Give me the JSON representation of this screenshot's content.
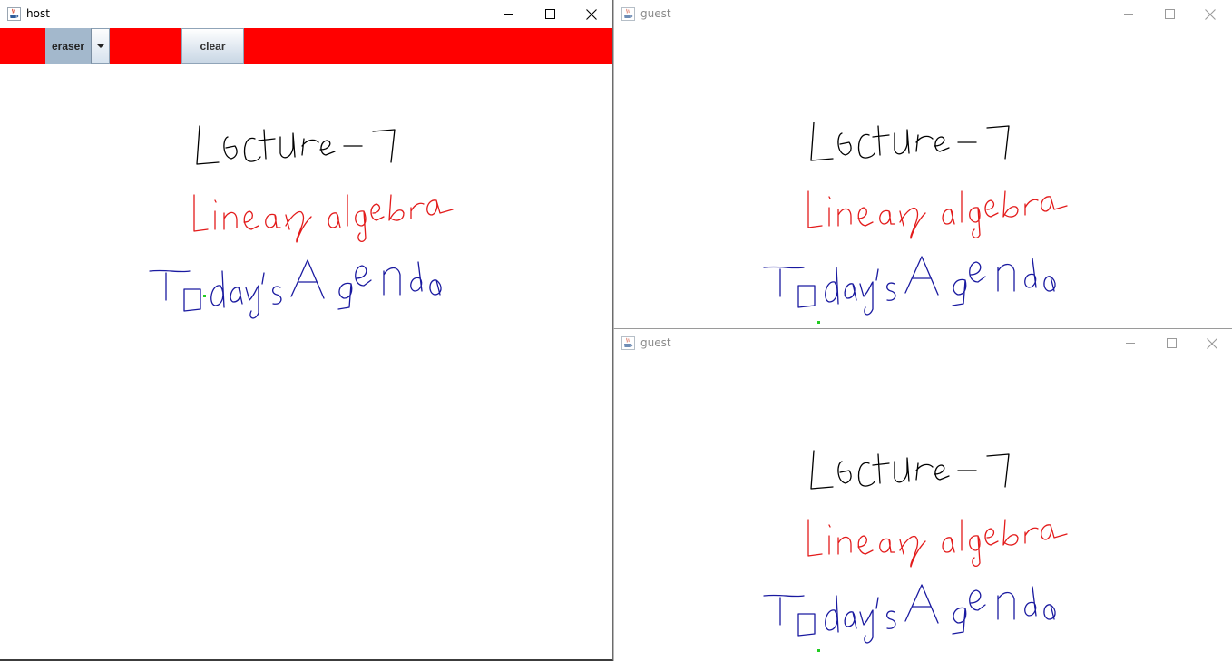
{
  "windows": {
    "host": {
      "title": "host"
    },
    "guest1": {
      "title": "guest"
    },
    "guest2": {
      "title": "guest"
    }
  },
  "toolbar": {
    "tool_select": {
      "selected": "eraser"
    },
    "clear_label": "clear",
    "background_color": "#ff0000"
  },
  "drawing": {
    "lines": [
      {
        "handwritten_text": "Lecture - 7",
        "color": "#000000"
      },
      {
        "handwritten_text": "Linear algebra",
        "color": "#e31b1b"
      },
      {
        "handwritten_text": "Today's Agenda",
        "color": "#1a1aa0"
      }
    ]
  },
  "icons": {
    "app": "java-coffee-cup-icon",
    "minimize": "minimize-icon",
    "maximize": "maximize-icon",
    "close": "close-icon",
    "dropdown": "chevron-down-icon"
  }
}
